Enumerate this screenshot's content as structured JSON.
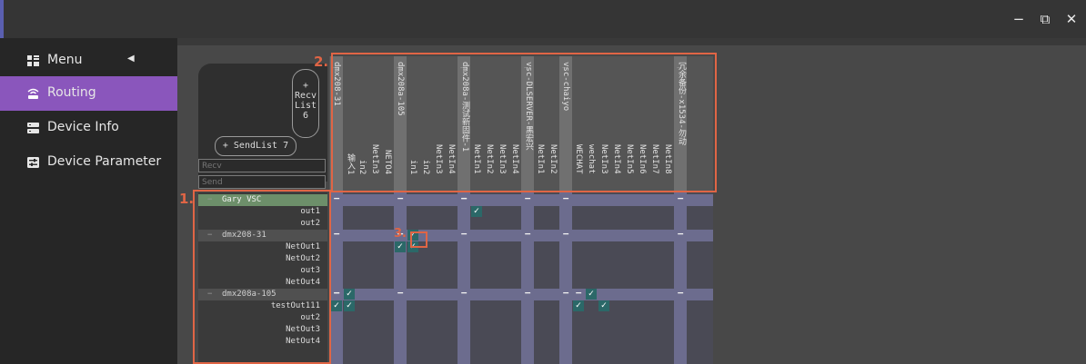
{
  "window": {
    "minimize_icon": "minimize-icon",
    "maximize_icon": "restore-window-icon",
    "close_icon": "close-icon",
    "minimize_glyph": "−",
    "maximize_glyph": "⧉",
    "close_glyph": "✕"
  },
  "sidebar": {
    "items": [
      {
        "label": "Menu",
        "icon": "menu-grid-icon",
        "active": false,
        "collapse_glyph": "◀"
      },
      {
        "label": "Routing",
        "icon": "wifi-router-icon",
        "active": true
      },
      {
        "label": "Device Info",
        "icon": "server-icon",
        "active": false
      },
      {
        "label": "Device Parameter",
        "icon": "sliders-icon",
        "active": false
      }
    ]
  },
  "routing": {
    "recv_list_button": {
      "plus": "+",
      "line1": "Recv",
      "line2": "List",
      "count": "6"
    },
    "send_list_button": "+ SendList 7",
    "recv_filter_placeholder": "Recv",
    "send_filter_placeholder": "Send",
    "receivers": [
      {
        "label": "dmx208-31",
        "type": "device"
      },
      {
        "label": "输入1",
        "type": "channel"
      },
      {
        "label": "in2",
        "type": "channel"
      },
      {
        "label": "NetIn3",
        "type": "channel"
      },
      {
        "label": "NETO4",
        "type": "channel"
      },
      {
        "label": "dmx208a-105",
        "type": "device"
      },
      {
        "label": "in1",
        "type": "channel"
      },
      {
        "label": "in2",
        "type": "channel"
      },
      {
        "label": "NetIn3",
        "type": "channel"
      },
      {
        "label": "NetIn4",
        "type": "channel"
      },
      {
        "label": "dmx208a-测试新固件-1",
        "type": "device"
      },
      {
        "label": "NetIn1",
        "type": "channel"
      },
      {
        "label": "NetIn2",
        "type": "channel"
      },
      {
        "label": "NetIn3",
        "type": "channel"
      },
      {
        "label": "NetIn4",
        "type": "channel"
      },
      {
        "label": "vsc-DLSERVER-黑宏兴",
        "type": "device"
      },
      {
        "label": "NetIn1",
        "type": "channel"
      },
      {
        "label": "NetIn2",
        "type": "channel"
      },
      {
        "label": "vsc-chaiyo",
        "type": "device"
      },
      {
        "label": "WECHAT",
        "type": "channel"
      },
      {
        "label": "wechat",
        "type": "channel"
      },
      {
        "label": "NetIn3",
        "type": "channel"
      },
      {
        "label": "NetIn4",
        "type": "channel"
      },
      {
        "label": "NetIn5",
        "type": "channel"
      },
      {
        "label": "NetIn6",
        "type": "channel"
      },
      {
        "label": "NetIn7",
        "type": "channel"
      },
      {
        "label": "NetIn8",
        "type": "channel"
      },
      {
        "label": "冗余备份-x1534-勿动",
        "type": "device"
      }
    ],
    "senders": [
      {
        "label": "Gary VSC",
        "type": "device"
      },
      {
        "label": "out1",
        "type": "channel"
      },
      {
        "label": "out2",
        "type": "channel"
      },
      {
        "label": "dmx208-31",
        "type": "device"
      },
      {
        "label": "NetOut1",
        "type": "channel"
      },
      {
        "label": "NetOut2",
        "type": "channel"
      },
      {
        "label": "out3",
        "type": "channel"
      },
      {
        "label": "NetOut4",
        "type": "channel"
      },
      {
        "label": "dmx208a-105",
        "type": "device"
      },
      {
        "label": "testOut111",
        "type": "channel"
      },
      {
        "label": "out2",
        "type": "channel"
      },
      {
        "label": "NetOut3",
        "type": "channel"
      },
      {
        "label": "NetOut4",
        "type": "channel"
      }
    ],
    "checked": [
      [
        1,
        11
      ],
      [
        3,
        6
      ],
      [
        4,
        5
      ],
      [
        4,
        6
      ],
      [
        8,
        1
      ],
      [
        9,
        0
      ],
      [
        9,
        1
      ],
      [
        8,
        20
      ],
      [
        9,
        19
      ],
      [
        9,
        21
      ]
    ],
    "partial": [
      [
        0,
        10
      ],
      [
        8,
        0
      ],
      [
        8,
        19
      ]
    ],
    "check_glyph": "✓",
    "partial_glyph": "−",
    "collapse_glyph": "−"
  },
  "annotations": [
    "1.",
    "2.",
    "3."
  ],
  "colors": {
    "accent": "#8a56bc",
    "checked_cell": "#2b6868",
    "grid_line": "#6c6c8e",
    "annotation": "#e06545",
    "selected_sender": "#6d8f6a"
  }
}
